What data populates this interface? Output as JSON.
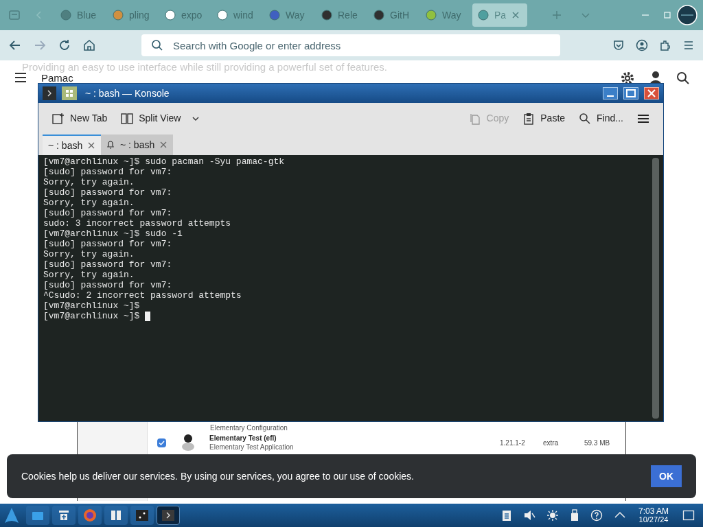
{
  "browser": {
    "tabs": [
      {
        "label": "Blue",
        "selected": false
      },
      {
        "label": "pling",
        "selected": false
      },
      {
        "label": "expo",
        "selected": false
      },
      {
        "label": "wind",
        "selected": false
      },
      {
        "label": "Way",
        "selected": false
      },
      {
        "label": "Rele",
        "selected": false
      },
      {
        "label": "GitH",
        "selected": false
      },
      {
        "label": "Way",
        "selected": false
      },
      {
        "label": "Pa",
        "selected": true
      }
    ],
    "address_bar": {
      "placeholder": "Search with Google or enter address"
    }
  },
  "page": {
    "tagline": "Providing an easy to use interface while still providing a powerful set of features.",
    "title": "Pamac",
    "packages": [
      {
        "description": "Elementary Configuration"
      },
      {
        "name": "Elementary Test (efl)",
        "description": "Elementary Test Application",
        "version": "1.21.1-2",
        "repo": "extra",
        "size": "59.3 MB",
        "checked": true
      }
    ]
  },
  "konsole": {
    "title": "~ : bash — Konsole",
    "toolbar": [
      {
        "label": "New Tab",
        "disabled": false
      },
      {
        "label": "Split View",
        "disabled": false
      },
      {
        "label": "Copy",
        "disabled": true
      },
      {
        "label": "Paste",
        "disabled": false
      },
      {
        "label": "Find...",
        "disabled": false
      }
    ],
    "tabs": [
      {
        "label": "~ : bash",
        "selected": true
      },
      {
        "label": "~ : bash",
        "selected": false
      }
    ],
    "lines": [
      "[vm7@archlinux ~]$ sudo pacman -Syu pamac-gtk",
      "[sudo] password for vm7:",
      "Sorry, try again.",
      "[sudo] password for vm7:",
      "Sorry, try again.",
      "[sudo] password for vm7:",
      "sudo: 3 incorrect password attempts",
      "[vm7@archlinux ~]$ sudo -i",
      "[sudo] password for vm7:",
      "Sorry, try again.",
      "[sudo] password for vm7:",
      "Sorry, try again.",
      "[sudo] password for vm7:",
      "^Csudo: 2 incorrect password attempts",
      "[vm7@archlinux ~]$",
      "[vm7@archlinux ~]$"
    ]
  },
  "cookie_banner": {
    "text": "Cookies help us deliver our services. By using our services, you agree to our use of cookies.",
    "button": "OK"
  },
  "taskbar": {
    "apps": [
      {
        "selected": false
      },
      {
        "selected": false
      },
      {
        "selected": false
      },
      {
        "selected": false
      },
      {
        "selected": false
      },
      {
        "selected": true
      }
    ],
    "time": "7:03 AM",
    "date": "10/27/24"
  }
}
